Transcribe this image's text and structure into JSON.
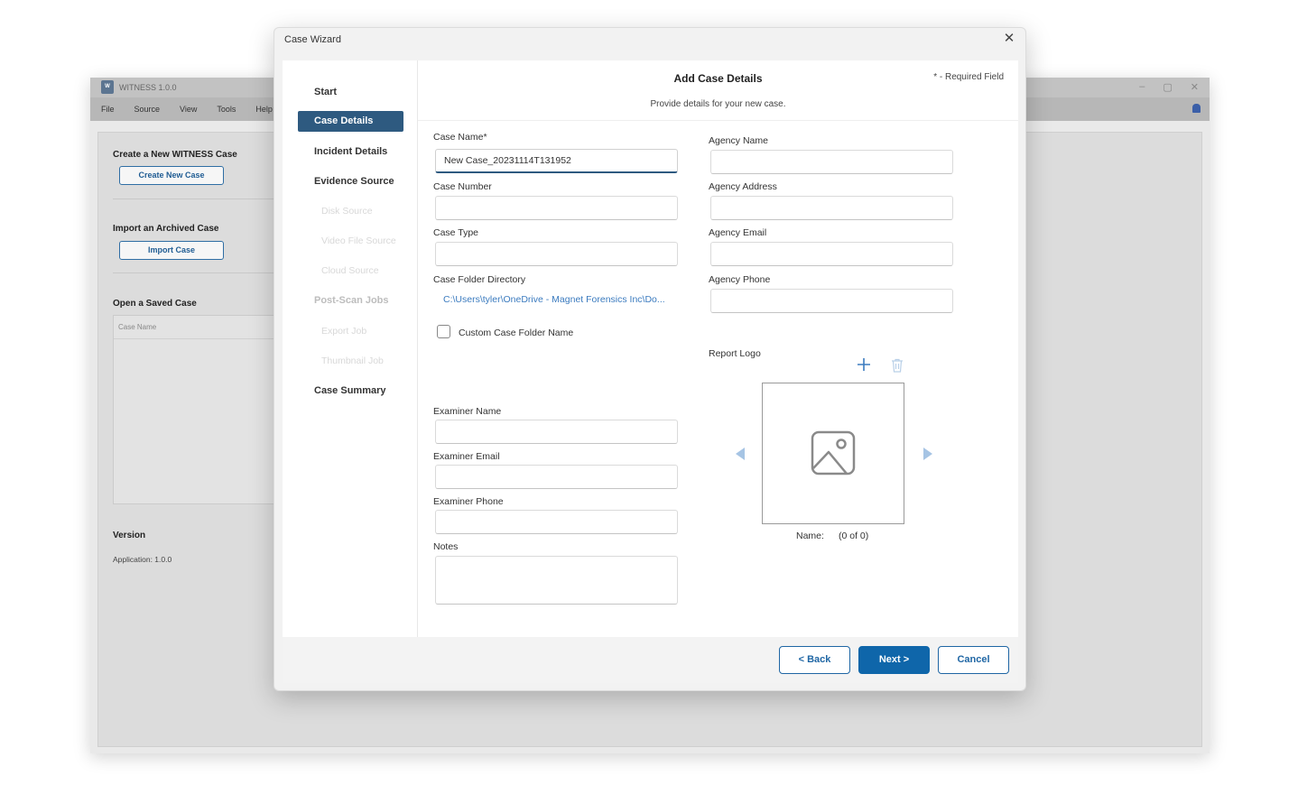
{
  "background_app": {
    "title": "WITNESS 1.0.0",
    "menu": [
      "File",
      "Source",
      "View",
      "Tools",
      "Help"
    ],
    "sections": {
      "create_heading": "Create a New WITNESS Case",
      "create_button": "Create New Case",
      "import_heading": "Import an Archived Case",
      "import_button": "Import Case",
      "open_heading": "Open a Saved Case",
      "list_column": "Case Name",
      "version_heading": "Version",
      "version_text": "Application:  1.0.0"
    },
    "window_controls": [
      "–",
      "▢",
      "✕"
    ]
  },
  "modal": {
    "title": "Case Wizard",
    "close_glyph": "✕",
    "heading": "Add Case Details",
    "subheading": "Provide details for your new case.",
    "required_note": "* - Required Field",
    "steps": [
      {
        "label": "Start",
        "state": "normal"
      },
      {
        "label": "Case Details",
        "state": "active"
      },
      {
        "label": "Incident Details",
        "state": "normal"
      },
      {
        "label": "Evidence Source",
        "state": "normal"
      },
      {
        "label": "Disk Source",
        "state": "disabled"
      },
      {
        "label": "Video File Source",
        "state": "disabled"
      },
      {
        "label": "Cloud Source",
        "state": "disabled"
      },
      {
        "label": "Post-Scan Jobs",
        "state": "muted"
      },
      {
        "label": "Export Job",
        "state": "disabled"
      },
      {
        "label": "Thumbnail Job",
        "state": "disabled"
      },
      {
        "label": "Case Summary",
        "state": "normal"
      }
    ],
    "fields": {
      "case_name_label": "Case Name*",
      "case_name_value": "New Case_20231114T131952",
      "case_number_label": "Case Number",
      "case_number_value": "",
      "case_type_label": "Case Type",
      "case_type_value": "",
      "case_folder_label": "Case Folder Directory",
      "case_folder_value": "C:\\Users\\tyler\\OneDrive - Magnet Forensics Inc\\Do...",
      "custom_folder_label": "Custom Case Folder Name",
      "custom_folder_checked": false,
      "agency_name_label": "Agency Name",
      "agency_address_label": "Agency Address",
      "agency_email_label": "Agency Email",
      "agency_phone_label": "Agency Phone",
      "examiner_name_label": "Examiner Name",
      "examiner_email_label": "Examiner Email",
      "examiner_phone_label": "Examiner Phone",
      "notes_label": "Notes"
    },
    "report_logo": {
      "label": "Report Logo",
      "name_label": "Name:",
      "counter": "(0 of 0)",
      "add_icon": "plus-icon",
      "delete_icon": "trash-icon"
    },
    "buttons": {
      "back": "< Back",
      "next": "Next >",
      "cancel": "Cancel"
    }
  },
  "colors": {
    "accent": "#0f66aa",
    "active_step": "#2e5a80",
    "link": "#3b7bbf",
    "disabled_text": "#d8d8d8"
  }
}
